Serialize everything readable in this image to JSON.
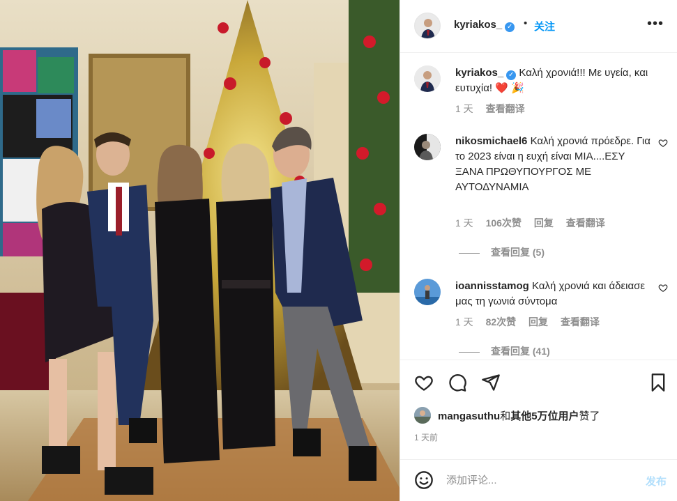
{
  "header": {
    "username": "kyriakos_",
    "separator": "•",
    "follow_label": "关注",
    "more_label": "•••"
  },
  "caption": {
    "username": "kyriakos_",
    "text": "Καλή χρονιά!!! Με υγεία, και ευτυχία! ❤️ 🎉",
    "time": "1 天",
    "translate_label": "查看翻译"
  },
  "comments": [
    {
      "username": "nikosmichael6",
      "text": "Καλή χρονιά πρόεδρε. Για το 2023 είναι η ευχή είναι ΜΙΑ....ΕΣΥ ΞΑΝΑ ΠΡΩΘΥΠΟΥΡΓΟΣ ΜΕ ΑΥΤΟΔΥΝΑΜΙΑ",
      "time": "1 天",
      "likes": "106次赞",
      "reply_label": "回复",
      "translate_label": "查看翻译",
      "view_replies": "查看回复 (5)"
    },
    {
      "username": "ioannisstamog",
      "text": "Καλή χρονιά και άδειασε μας τη γωνιά σύντομα",
      "time": "1 天",
      "likes": "82次赞",
      "reply_label": "回复",
      "translate_label": "查看翻译",
      "view_replies": "查看回复 (41)"
    }
  ],
  "likes": {
    "user": "mangasuthu",
    "joiner": "和",
    "others": "其他5万位用户",
    "suffix": "赞了"
  },
  "time_ago": "1 天前",
  "add_comment": {
    "placeholder": "添加评论...",
    "post_label": "发布"
  },
  "icons": {
    "more": "more-dots-icon",
    "verified": "verified-badge-icon",
    "heart": "heart-outline-icon",
    "comment": "comment-bubble-icon",
    "share": "paper-plane-icon",
    "save": "bookmark-icon",
    "emoji": "smiley-icon"
  },
  "colors": {
    "link_blue": "#0095f6",
    "verified_blue": "#3897f0",
    "muted": "#8e8e8e",
    "post_disabled": "#b2dffc",
    "like_red": "#ed4956"
  }
}
